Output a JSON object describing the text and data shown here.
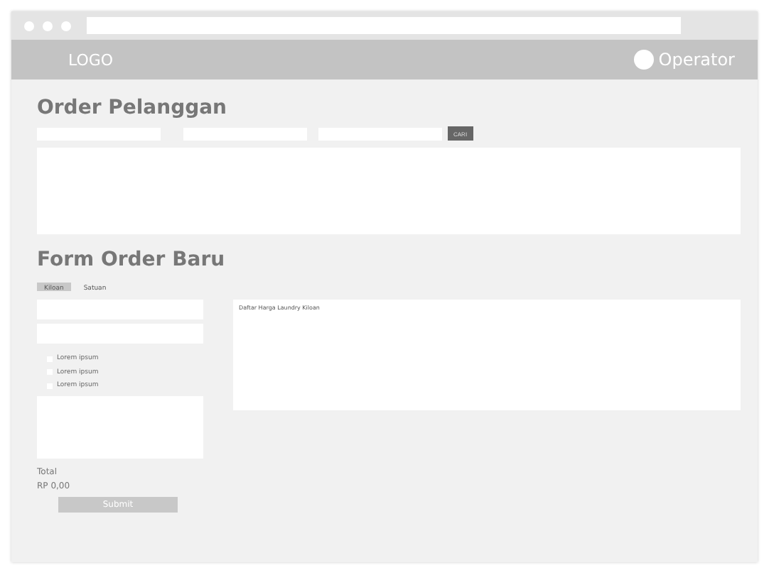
{
  "header": {
    "logo": "LOGO",
    "user": "Operator"
  },
  "order_pelanggan": {
    "title": "Order Pelanggan",
    "search_button": "CARI"
  },
  "form_order_baru": {
    "title": "Form Order Baru",
    "tabs": [
      {
        "label": "Kiloan",
        "selected": true
      },
      {
        "label": "Satuan",
        "selected": false
      }
    ],
    "options": [
      {
        "label": "Lorem ipsum",
        "checked": false
      },
      {
        "label": "Lorem ipsum",
        "checked": false
      },
      {
        "label": "Lorem ipsum",
        "checked": false
      }
    ],
    "total_label": "Total",
    "total_value": "RP 0,00",
    "submit": "Submit",
    "price_panel_title": "Daftar Harga Laundry Kiloan"
  }
}
